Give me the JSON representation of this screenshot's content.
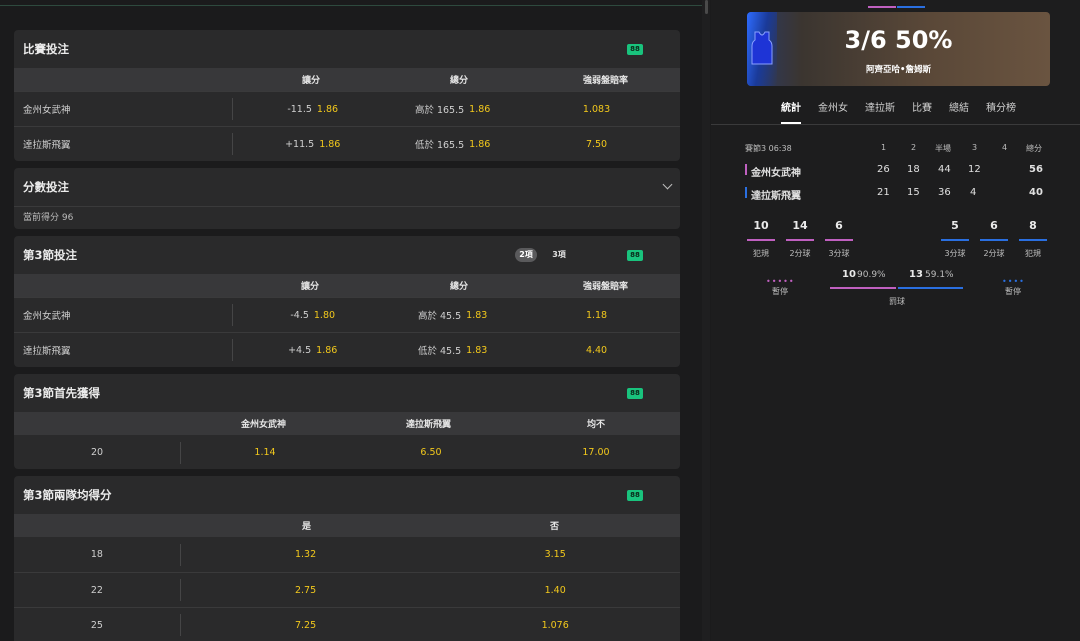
{
  "match_odds": {
    "title": "比賽投注",
    "col_spread": "讓分",
    "col_total": "總分",
    "col_ml": "強弱盤賠率",
    "rows": [
      {
        "team": "金州女武神",
        "spread": "-11.5",
        "spread_odd": "1.86",
        "total": "高於 165.5",
        "total_odd": "1.86",
        "ml": "1.083"
      },
      {
        "team": "達拉斯飛翼",
        "spread": "+11.5",
        "spread_odd": "1.86",
        "total": "低於 165.5",
        "total_odd": "1.86",
        "ml": "7.50"
      }
    ]
  },
  "score_bet": {
    "title": "分數投注",
    "current": "當前得分 96"
  },
  "q3_bet": {
    "title": "第3節投注",
    "pill_2": "2項",
    "pill_3": "3項",
    "col_spread": "讓分",
    "col_total": "總分",
    "col_ml": "強弱盤賠率",
    "rows": [
      {
        "team": "金州女武神",
        "spread": "-4.5",
        "spread_odd": "1.80",
        "total": "高於 45.5",
        "total_odd": "1.83",
        "ml": "1.18"
      },
      {
        "team": "達拉斯飛翼",
        "spread": "+4.5",
        "spread_odd": "1.86",
        "total": "低於 45.5",
        "total_odd": "1.83",
        "ml": "4.40"
      }
    ]
  },
  "q3_first": {
    "title": "第3節首先獲得",
    "col_a": "金州女武神",
    "col_b": "達拉斯飛翼",
    "col_c": "均不",
    "row": {
      "label": "20",
      "a": "1.14",
      "b": "6.50",
      "c": "17.00"
    }
  },
  "q3_both": {
    "title": "第3節兩隊均得分",
    "col_yes": "是",
    "col_no": "否",
    "rows": [
      {
        "label": "18",
        "yes": "1.32",
        "no": "3.15"
      },
      {
        "label": "22",
        "yes": "2.75",
        "no": "1.40"
      },
      {
        "label": "25",
        "yes": "7.25",
        "no": "1.076"
      }
    ]
  },
  "badge": "88",
  "banner": {
    "stat": "3/6 50%",
    "player": "阿齊亞哈•詹姆斯"
  },
  "tabs": [
    "統計",
    "金州女",
    "達拉斯",
    "比賽",
    "總結",
    "積分榜"
  ],
  "scoreboard": {
    "period": "賽節3 06:38",
    "headers": [
      "1",
      "2",
      "半場",
      "3",
      "4",
      "總分"
    ],
    "teams": [
      {
        "name": "金州女武神",
        "q": [
          "26",
          "18",
          "44",
          "12",
          ""
        ],
        "total": "56",
        "color": "#c060c0"
      },
      {
        "name": "達拉斯飛翼",
        "q": [
          "21",
          "15",
          "36",
          "4",
          ""
        ],
        "total": "40",
        "color": "#2a6fe0"
      }
    ]
  },
  "stats": {
    "home": [
      {
        "n": "10",
        "l": "犯規"
      },
      {
        "n": "14",
        "l": "2分球"
      },
      {
        "n": "6",
        "l": "3分球"
      }
    ],
    "away": [
      {
        "n": "5",
        "l": "3分球"
      },
      {
        "n": "6",
        "l": "2分球"
      },
      {
        "n": "8",
        "l": "犯規"
      }
    ],
    "timeout": "暫停",
    "ft_home": "10",
    "ft_home_pct": "90.9%",
    "ft_away": "13",
    "ft_away_pct": "59.1%",
    "ft_label": "罰球"
  }
}
